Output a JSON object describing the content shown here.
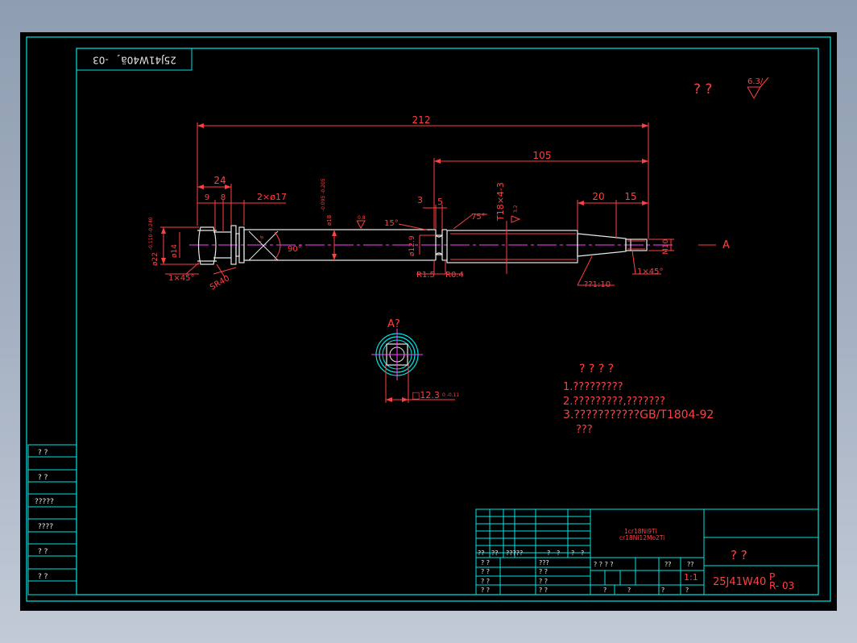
{
  "stamp": {
    "text": "25J41W40ä¸-03"
  },
  "roughness": {
    "marks": "?  ?",
    "value": "6.3/"
  },
  "dims": {
    "overall": "212",
    "d105": "105",
    "d24": "24",
    "d9": "9",
    "d8": "8",
    "groove": "2×ø17",
    "d3": "3",
    "d5": "5",
    "d20": "20",
    "d15": "15",
    "thread": "T18×4-3",
    "phi22": "ø22",
    "phi22_tol": "-0.110 -0.240",
    "phi14": "ø14",
    "phi18": "ø18",
    "phi18_tol": "-0.095 -0.205",
    "phi129": "ø12.9",
    "m10": "M10",
    "ang15": "15°",
    "ang75": "75°",
    "ang90": "90°",
    "chamfer1": "1×45°",
    "chamfer2": "1×45°",
    "sr": "SR40",
    "r15": "R1.5",
    "r04": "R0.4",
    "taper": "??1:10",
    "rough_small": "0.8",
    "rough_small2": "1.6",
    "rough_small3": "3.2",
    "a_label": "A"
  },
  "view": {
    "label": "A?",
    "square": "□12.3",
    "square_tol": "0 -0.11"
  },
  "notes": {
    "title": "?  ?  ?  ?",
    "line1": "1.?????????",
    "line2": "2.?????????,???????",
    "line3": "3.???????????GB/T1804-92",
    "line4": "???"
  },
  "left_table": {
    "cells": [
      "?   ?",
      "?   ?",
      "?????",
      "????",
      "?   ?",
      "?   ?"
    ]
  },
  "title_block": {
    "material_line1": "1cr18Ni9Ti",
    "material_line2": "cr18Ni12Mo2Ti",
    "sign_header": [
      "??",
      "??",
      "?????",
      "?",
      "?",
      "?",
      "?"
    ],
    "rows_left": [
      "?  ?",
      "?  ?",
      "?  ?",
      "?  ?"
    ],
    "rows_mid": [
      "???",
      "?  ?",
      "?  ?",
      "?  ?"
    ],
    "stage_header": "?  ?  ?  ?",
    "weight_header": "??",
    "scale_header": "??",
    "scale": "1:1",
    "sheet_row": [
      "?",
      "?",
      "?",
      "?"
    ],
    "part_name": "?     ?",
    "code_main": "25J41W40",
    "code_p": "P",
    "code_r": "R- 03"
  }
}
